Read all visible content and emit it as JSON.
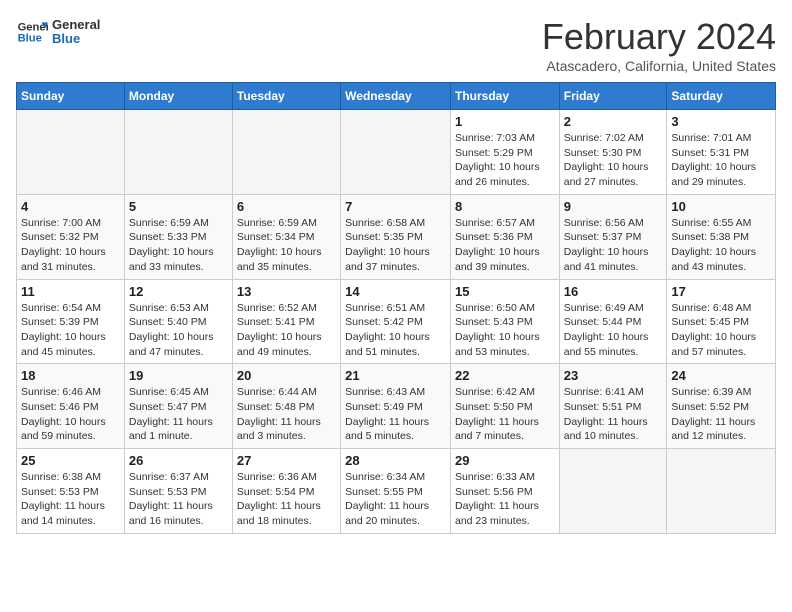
{
  "header": {
    "logo_line1": "General",
    "logo_line2": "Blue",
    "title": "February 2024",
    "location": "Atascadero, California, United States"
  },
  "weekdays": [
    "Sunday",
    "Monday",
    "Tuesday",
    "Wednesday",
    "Thursday",
    "Friday",
    "Saturday"
  ],
  "weeks": [
    [
      {
        "num": "",
        "detail": ""
      },
      {
        "num": "",
        "detail": ""
      },
      {
        "num": "",
        "detail": ""
      },
      {
        "num": "",
        "detail": ""
      },
      {
        "num": "1",
        "detail": "Sunrise: 7:03 AM\nSunset: 5:29 PM\nDaylight: 10 hours\nand 26 minutes."
      },
      {
        "num": "2",
        "detail": "Sunrise: 7:02 AM\nSunset: 5:30 PM\nDaylight: 10 hours\nand 27 minutes."
      },
      {
        "num": "3",
        "detail": "Sunrise: 7:01 AM\nSunset: 5:31 PM\nDaylight: 10 hours\nand 29 minutes."
      }
    ],
    [
      {
        "num": "4",
        "detail": "Sunrise: 7:00 AM\nSunset: 5:32 PM\nDaylight: 10 hours\nand 31 minutes."
      },
      {
        "num": "5",
        "detail": "Sunrise: 6:59 AM\nSunset: 5:33 PM\nDaylight: 10 hours\nand 33 minutes."
      },
      {
        "num": "6",
        "detail": "Sunrise: 6:59 AM\nSunset: 5:34 PM\nDaylight: 10 hours\nand 35 minutes."
      },
      {
        "num": "7",
        "detail": "Sunrise: 6:58 AM\nSunset: 5:35 PM\nDaylight: 10 hours\nand 37 minutes."
      },
      {
        "num": "8",
        "detail": "Sunrise: 6:57 AM\nSunset: 5:36 PM\nDaylight: 10 hours\nand 39 minutes."
      },
      {
        "num": "9",
        "detail": "Sunrise: 6:56 AM\nSunset: 5:37 PM\nDaylight: 10 hours\nand 41 minutes."
      },
      {
        "num": "10",
        "detail": "Sunrise: 6:55 AM\nSunset: 5:38 PM\nDaylight: 10 hours\nand 43 minutes."
      }
    ],
    [
      {
        "num": "11",
        "detail": "Sunrise: 6:54 AM\nSunset: 5:39 PM\nDaylight: 10 hours\nand 45 minutes."
      },
      {
        "num": "12",
        "detail": "Sunrise: 6:53 AM\nSunset: 5:40 PM\nDaylight: 10 hours\nand 47 minutes."
      },
      {
        "num": "13",
        "detail": "Sunrise: 6:52 AM\nSunset: 5:41 PM\nDaylight: 10 hours\nand 49 minutes."
      },
      {
        "num": "14",
        "detail": "Sunrise: 6:51 AM\nSunset: 5:42 PM\nDaylight: 10 hours\nand 51 minutes."
      },
      {
        "num": "15",
        "detail": "Sunrise: 6:50 AM\nSunset: 5:43 PM\nDaylight: 10 hours\nand 53 minutes."
      },
      {
        "num": "16",
        "detail": "Sunrise: 6:49 AM\nSunset: 5:44 PM\nDaylight: 10 hours\nand 55 minutes."
      },
      {
        "num": "17",
        "detail": "Sunrise: 6:48 AM\nSunset: 5:45 PM\nDaylight: 10 hours\nand 57 minutes."
      }
    ],
    [
      {
        "num": "18",
        "detail": "Sunrise: 6:46 AM\nSunset: 5:46 PM\nDaylight: 10 hours\nand 59 minutes."
      },
      {
        "num": "19",
        "detail": "Sunrise: 6:45 AM\nSunset: 5:47 PM\nDaylight: 11 hours\nand 1 minute."
      },
      {
        "num": "20",
        "detail": "Sunrise: 6:44 AM\nSunset: 5:48 PM\nDaylight: 11 hours\nand 3 minutes."
      },
      {
        "num": "21",
        "detail": "Sunrise: 6:43 AM\nSunset: 5:49 PM\nDaylight: 11 hours\nand 5 minutes."
      },
      {
        "num": "22",
        "detail": "Sunrise: 6:42 AM\nSunset: 5:50 PM\nDaylight: 11 hours\nand 7 minutes."
      },
      {
        "num": "23",
        "detail": "Sunrise: 6:41 AM\nSunset: 5:51 PM\nDaylight: 11 hours\nand 10 minutes."
      },
      {
        "num": "24",
        "detail": "Sunrise: 6:39 AM\nSunset: 5:52 PM\nDaylight: 11 hours\nand 12 minutes."
      }
    ],
    [
      {
        "num": "25",
        "detail": "Sunrise: 6:38 AM\nSunset: 5:53 PM\nDaylight: 11 hours\nand 14 minutes."
      },
      {
        "num": "26",
        "detail": "Sunrise: 6:37 AM\nSunset: 5:53 PM\nDaylight: 11 hours\nand 16 minutes."
      },
      {
        "num": "27",
        "detail": "Sunrise: 6:36 AM\nSunset: 5:54 PM\nDaylight: 11 hours\nand 18 minutes."
      },
      {
        "num": "28",
        "detail": "Sunrise: 6:34 AM\nSunset: 5:55 PM\nDaylight: 11 hours\nand 20 minutes."
      },
      {
        "num": "29",
        "detail": "Sunrise: 6:33 AM\nSunset: 5:56 PM\nDaylight: 11 hours\nand 23 minutes."
      },
      {
        "num": "",
        "detail": ""
      },
      {
        "num": "",
        "detail": ""
      }
    ]
  ]
}
